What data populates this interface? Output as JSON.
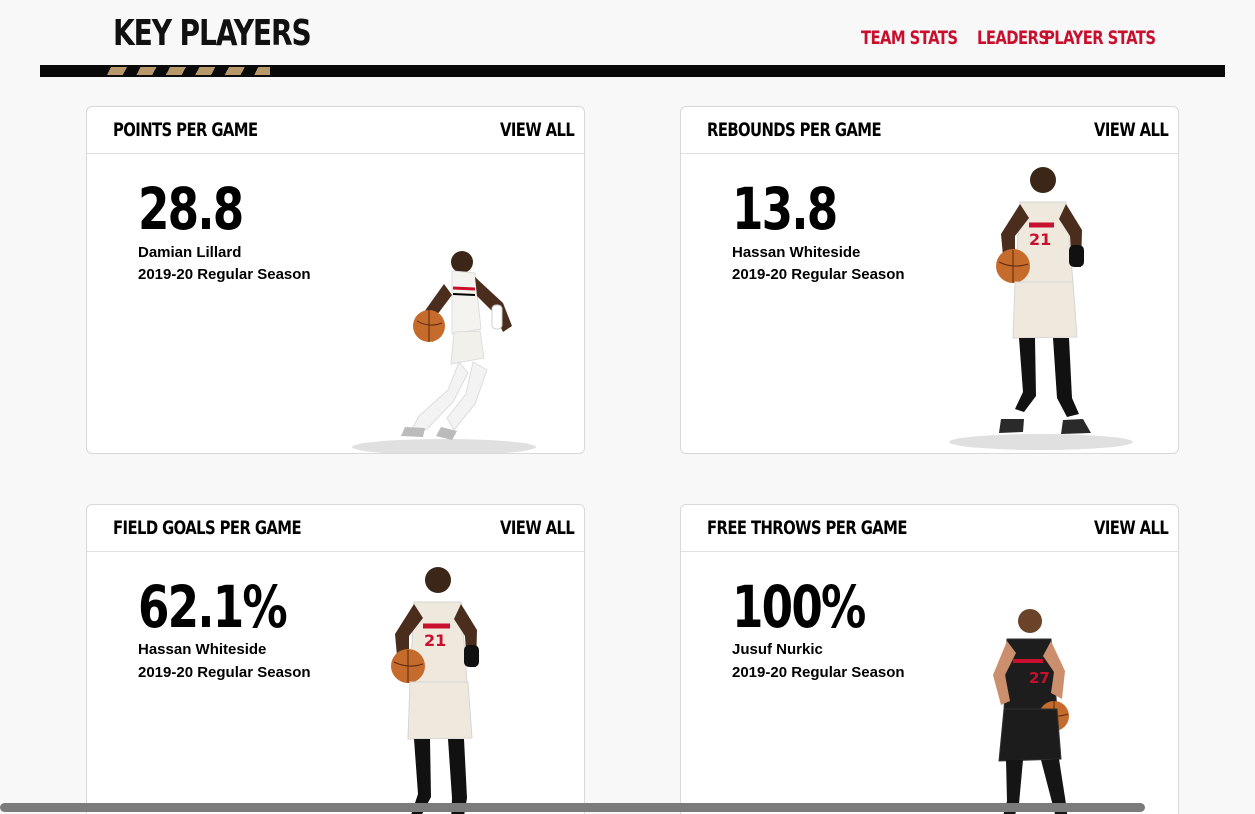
{
  "header": {
    "title": "KEY PLAYERS",
    "nav": [
      "TEAM STATS",
      "LEADERS",
      "PLAYER STATS"
    ]
  },
  "cards": [
    {
      "title": "POINTS PER GAME",
      "view_all": "VIEW ALL",
      "value": "28.8",
      "player": "Damian Lillard",
      "season": "2019-20 Regular Season",
      "jersey": "white"
    },
    {
      "title": "REBOUNDS PER GAME",
      "view_all": "VIEW ALL",
      "value": "13.8",
      "player": "Hassan Whiteside",
      "season": "2019-20 Regular Season",
      "jersey": "cream"
    },
    {
      "title": "FIELD GOALS PER GAME",
      "view_all": "VIEW ALL",
      "value": "62.1%",
      "player": "Hassan Whiteside",
      "season": "2019-20 Regular Season",
      "jersey": "cream"
    },
    {
      "title": "FREE THROWS PER GAME",
      "view_all": "VIEW ALL",
      "value": "100%",
      "player": "Jusuf Nurkic",
      "season": "2019-20 Regular Season",
      "jersey": "black"
    }
  ],
  "colors": {
    "accent": "#c8102e",
    "stripe_gold": "#c9a874",
    "text": "#000000"
  },
  "icons": [
    "player-photo",
    "player-photo",
    "player-photo",
    "player-photo"
  ]
}
